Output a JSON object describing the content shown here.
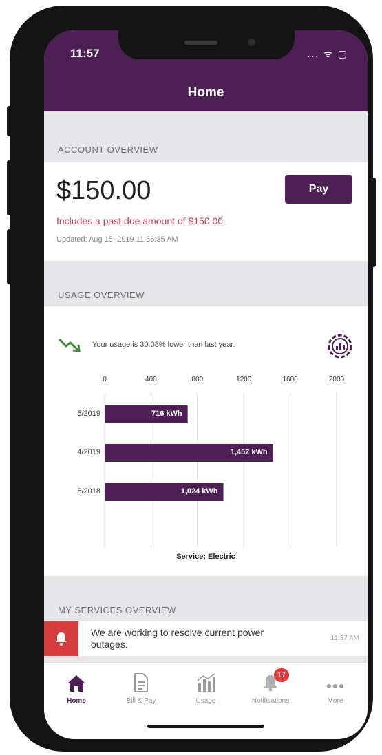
{
  "status_bar": {
    "time": "11:57",
    "icons": "... ᯤ ▢"
  },
  "header": {
    "title": "Home"
  },
  "account_overview": {
    "section_title": "ACCOUNT OVERVIEW",
    "amount": "$150.00",
    "pay_label": "Pay",
    "past_due_text": "Includes a past due amount of $150.00",
    "updated_text": "Updated: Aug 15, 2019 11:56:35 AM",
    "past_due_color": "#d83a4c"
  },
  "usage_overview": {
    "section_title": "USAGE OVERVIEW",
    "trend_text": "Your usage is 30.08% lower than last year.",
    "trend_icon": "trending-down-icon",
    "settings_icon": "chart-settings-icon",
    "service_text": "Service: Electric"
  },
  "chart_data": {
    "type": "bar",
    "orientation": "horizontal",
    "categories": [
      "5/2019",
      "4/2019",
      "5/2018"
    ],
    "values": [
      716,
      1452,
      1024
    ],
    "data_labels": [
      "716 kWh",
      "1,452 kWh",
      "1,024 kWh"
    ],
    "ticks": [
      0,
      400,
      800,
      1200,
      1600,
      2000
    ],
    "tick_labels": [
      "0",
      "400",
      "800",
      "1200",
      "1600",
      "2000"
    ],
    "xlim": [
      0,
      2000
    ],
    "grid": true,
    "bar_color": "#4e1f55"
  },
  "services_overview": {
    "section_title": "MY SERVICES OVERVIEW",
    "alert_text": "We are working to resolve current power outages.",
    "alert_time": "11:37 AM",
    "alert_icon": "bell-icon",
    "alert_color": "#d63e3e"
  },
  "tabbar": {
    "items": [
      {
        "label": "Home",
        "icon": "home-icon"
      },
      {
        "label": "Bill & Pay",
        "icon": "document-icon"
      },
      {
        "label": "Usage",
        "icon": "bar-chart-icon"
      },
      {
        "label": "Notifications",
        "icon": "bell-icon",
        "badge": "17"
      },
      {
        "label": "More",
        "icon": "more-icon"
      }
    ]
  },
  "colors": {
    "brand": "#4e1f55",
    "background": "#e6e5e7"
  }
}
